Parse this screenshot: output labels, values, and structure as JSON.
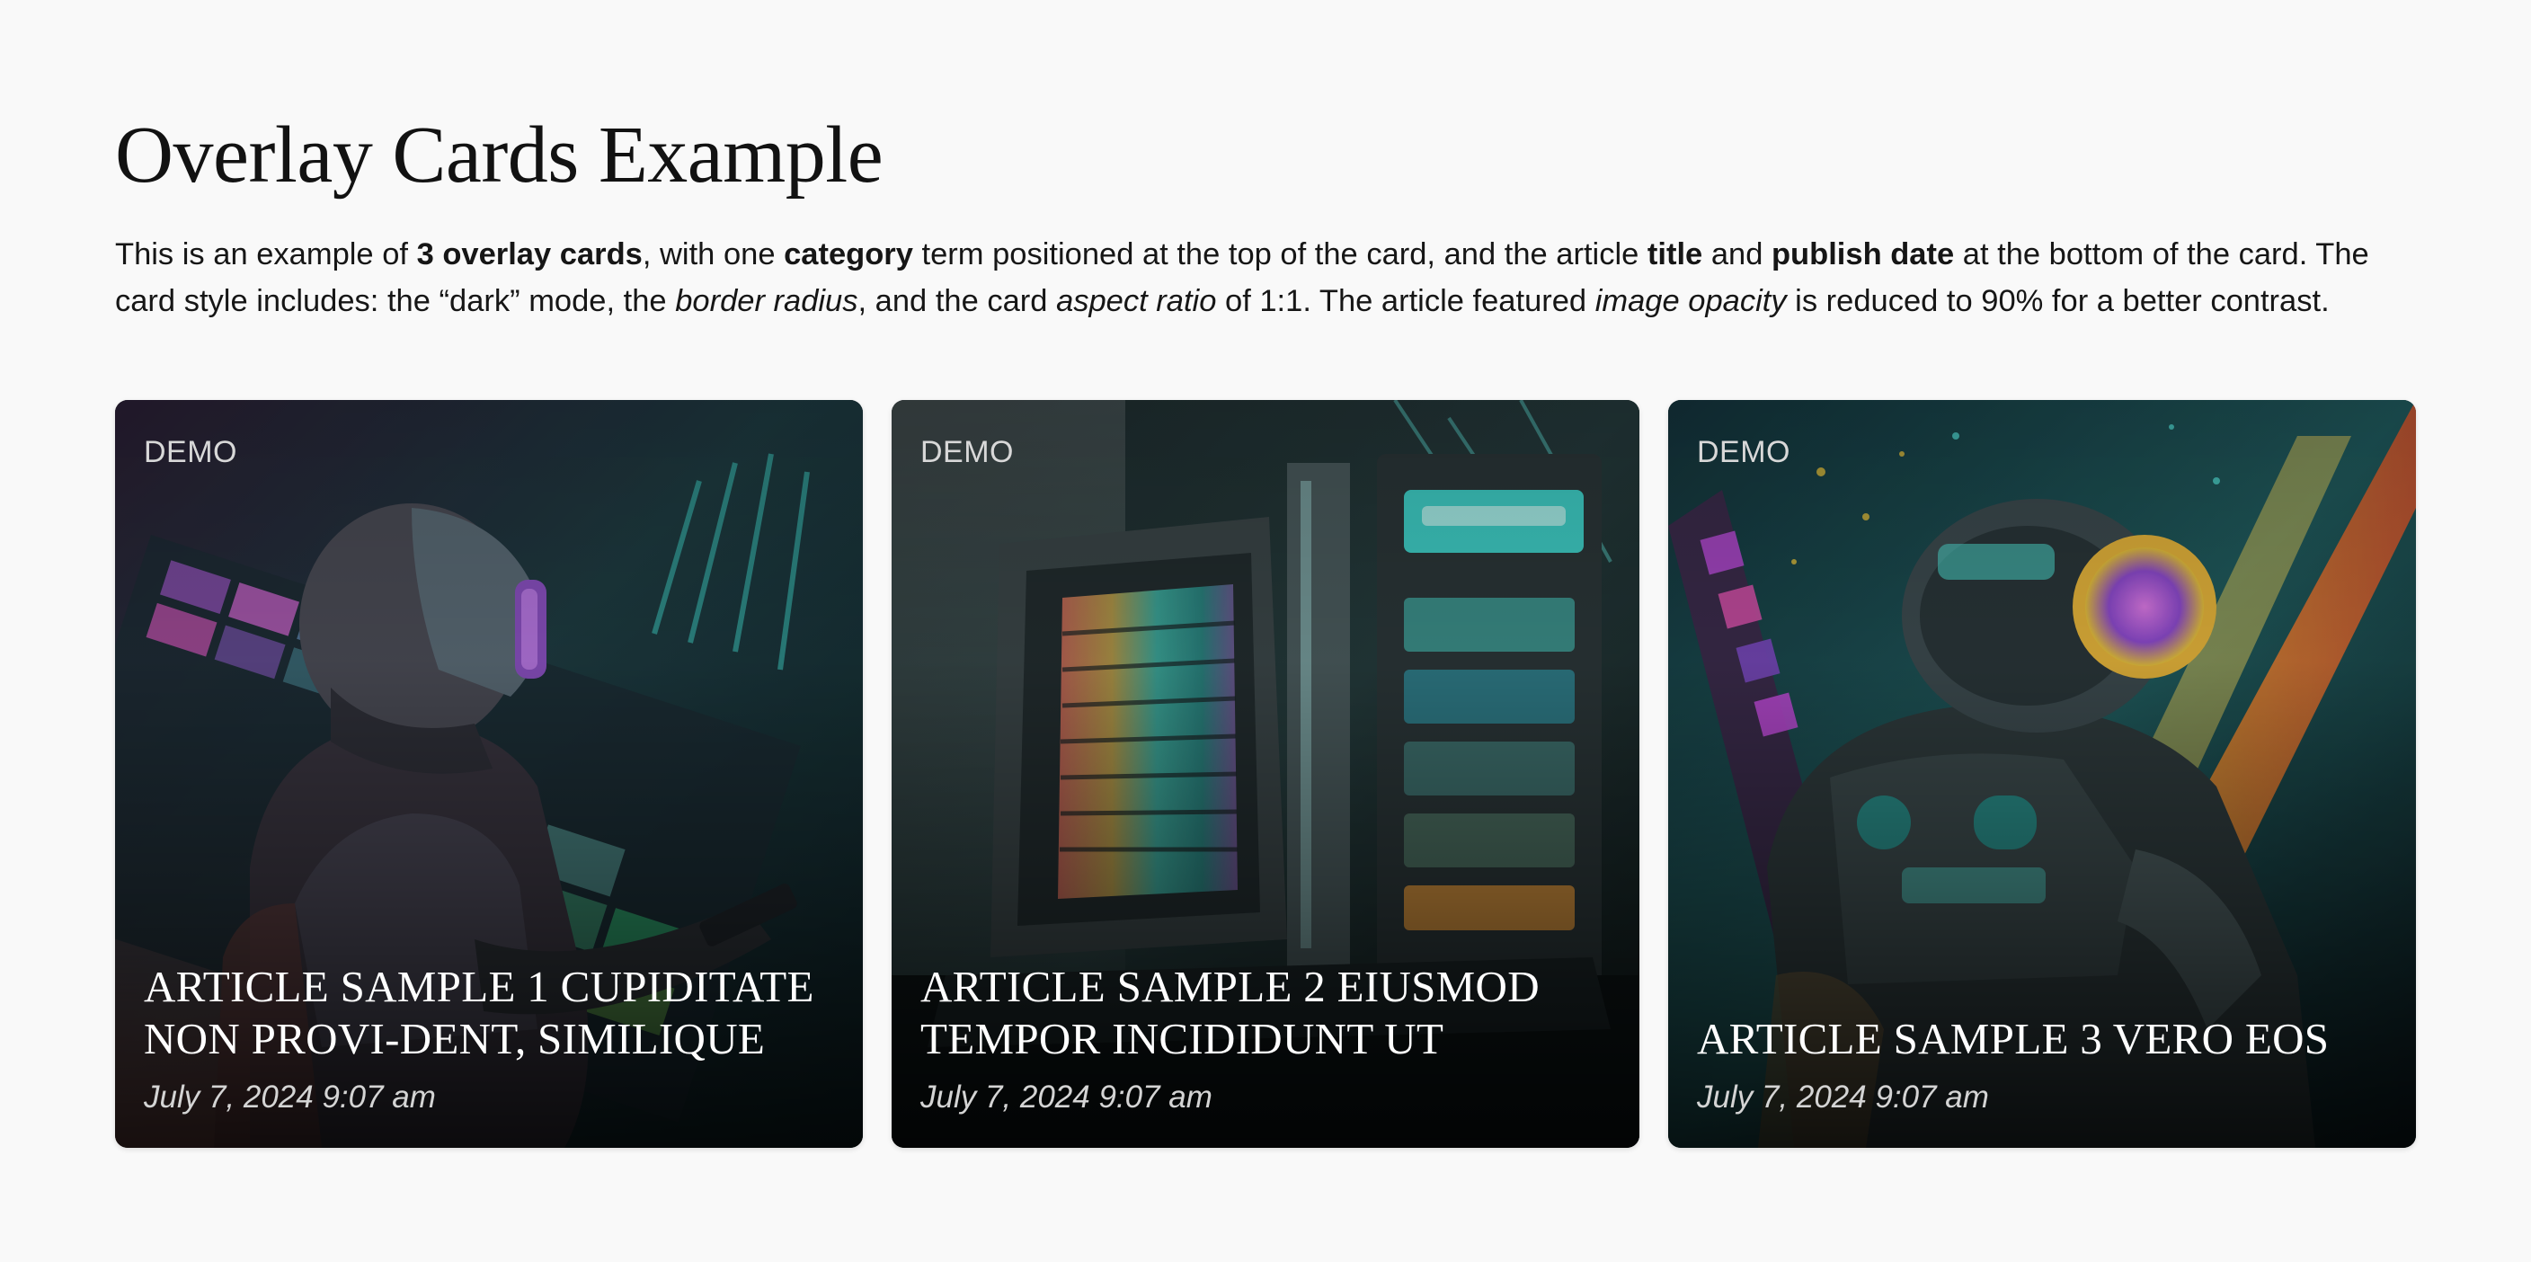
{
  "page": {
    "title": "Overlay Cards Example",
    "intro": {
      "t1": "This is an example of ",
      "b1": "3 overlay cards",
      "t2": ", with one ",
      "b2": "category",
      "t3": " term positioned at the top of the card, and the article ",
      "b3": "title",
      "t4": " and ",
      "b4": "publish date",
      "t5": " at the bottom of the card. The card style includes: the “dark” mode, the ",
      "i1": "border radius",
      "t6": ", and the card ",
      "i2": "aspect ratio",
      "t7": " of 1:1. The article featured ",
      "i3": "image opacity",
      "t8": " is reduced to 90% for a better contrast."
    }
  },
  "cards": [
    {
      "category": "DEMO",
      "title": "ARTICLE SAMPLE 1 CUPIDITATE NON PROVI-DENT, SIMILIQUE",
      "date": "July 7, 2024 9:07 am",
      "image_icon": "armored-figure-illustration"
    },
    {
      "category": "DEMO",
      "title": "ARTICLE SAMPLE 2 EIUSMOD TEMPOR INCIDIDUNT UT",
      "date": "July 7, 2024 9:07 am",
      "image_icon": "futuristic-machine-illustration"
    },
    {
      "category": "DEMO",
      "title": "ARTICLE SAMPLE 3 VERO EOS",
      "date": "July 7, 2024 9:07 am",
      "image_icon": "robot-astronaut-illustration"
    }
  ],
  "theme": {
    "background": "#f9f9f9",
    "card_dark": "#0b1214",
    "accent_teal": "#2fd1c5",
    "accent_magenta": "#c04bd8",
    "accent_gold": "#e8b53a"
  }
}
